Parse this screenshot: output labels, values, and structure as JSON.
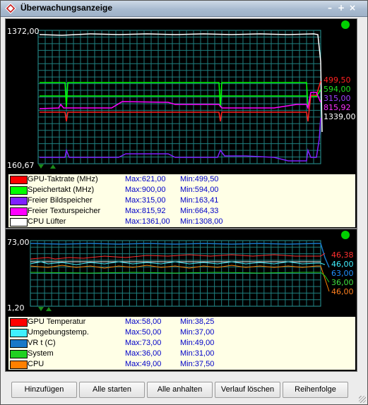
{
  "window": {
    "title": "Überwachungsanzeige",
    "title_icon": "app-logo-icon",
    "controls": [
      "minimize-icon",
      "maximize-icon",
      "close-icon"
    ]
  },
  "panels": [
    {
      "id": "top",
      "axis_top": "1372,00",
      "axis_bottom": "160,67",
      "status_color": "#00d000",
      "right_labels": [
        {
          "text": "499,50",
          "color": "#ff2020"
        },
        {
          "text": "594,00",
          "color": "#20e020"
        },
        {
          "text": "315,00",
          "color": "#a040ff"
        },
        {
          "text": "815,92",
          "color": "#ff30ff"
        },
        {
          "text": "1339,00",
          "color": "#ffffff"
        }
      ],
      "legend": [
        {
          "name": "GPU-Taktrate (MHz)",
          "color": "#ff0000",
          "max": "Max:621,00",
          "min": "Min:499,50"
        },
        {
          "name": "Speichertakt (MHz)",
          "color": "#00ff00",
          "max": "Max:900,00",
          "min": "Min:594,00"
        },
        {
          "name": "Freier Bildspeicher",
          "color": "#8020ff",
          "max": "Max:315,00",
          "min": "Min:163,41"
        },
        {
          "name": "Freier Texturspeicher",
          "color": "#ff00ff",
          "max": "Max:815,92",
          "min": "Min:664,33"
        },
        {
          "name": "CPU Lüfter",
          "color": "#ffffff",
          "max": "Max:1361,00",
          "min": "Min:1308,00"
        }
      ]
    },
    {
      "id": "bottom",
      "axis_top": "73,00",
      "axis_bottom": "1,20",
      "status_color": "#00d000",
      "right_labels": [
        {
          "text": "46,38",
          "color": "#ff3030"
        },
        {
          "text": "46,00",
          "color": "#40f0ff"
        },
        {
          "text": "63,00",
          "color": "#2090ff"
        },
        {
          "text": "36,00",
          "color": "#40e040"
        },
        {
          "text": "46,00",
          "color": "#ff8020"
        }
      ],
      "legend": [
        {
          "name": "GPU Temperatur",
          "color": "#ff0000",
          "max": "Max:58,00",
          "min": "Min:38,25"
        },
        {
          "name": "Umgebungstemp.",
          "color": "#40f0ff",
          "max": "Max:50,00",
          "min": "Min:37,00"
        },
        {
          "name": "VR t (C)",
          "color": "#1878c8",
          "max": "Max:73,00",
          "min": "Min:49,00"
        },
        {
          "name": "System",
          "color": "#20d020",
          "max": "Max:36,00",
          "min": "Min:31,00"
        },
        {
          "name": "CPU",
          "color": "#ff8000",
          "max": "Max:49,00",
          "min": "Min:37,50"
        }
      ]
    }
  ],
  "buttons": [
    "Hinzufügen",
    "Alle starten",
    "Alle anhalten",
    "Verlauf löschen",
    "Reihenfolge"
  ]
}
